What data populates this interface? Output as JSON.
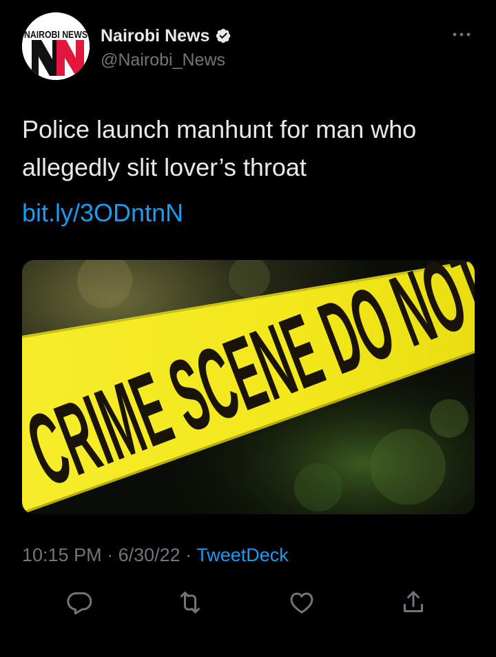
{
  "account": {
    "avatar_logo_text": "NAIROBI NEWS",
    "avatar_logo_letters": "NN",
    "display_name": "Nairobi News",
    "handle": "@Nairobi_News",
    "verified_icon": "verified-badge-icon",
    "more_icon": "more-options-icon"
  },
  "tweet": {
    "text": "Police launch manhunt for man who allegedly slit lover’s throat",
    "link": "bit.ly/3ODntnN"
  },
  "media": {
    "tape_text": "CRIME SCENE DO NOT"
  },
  "meta": {
    "time": "10:15 PM",
    "separator_1": " · ",
    "date": "6/30/22",
    "separator_2": " · ",
    "source": "TweetDeck"
  },
  "actions": [
    {
      "icon": "reply-icon"
    },
    {
      "icon": "retweet-icon"
    },
    {
      "icon": "like-icon"
    },
    {
      "icon": "share-icon"
    }
  ],
  "colors": {
    "background": "#000000",
    "text_primary": "#e7e9ea",
    "text_secondary": "#71767b",
    "link": "#1d9bf0",
    "tape_yellow": "#f2e61a",
    "logo_red": "#e3173e"
  }
}
